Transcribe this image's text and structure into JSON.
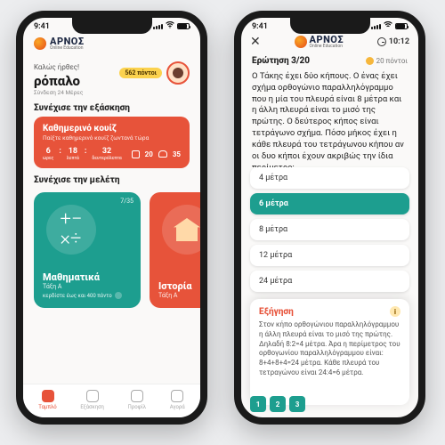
{
  "status": {
    "time": "9:41"
  },
  "brand": {
    "name": "ΑΡΝΟΣ",
    "sub": "Online Education"
  },
  "home": {
    "greeting_small": "Καλώς ήρθες!",
    "username": "ρόπαλο",
    "points_badge": "562 πόντοι",
    "streak": "Σύνδεση 24 Μέρες",
    "section_practice": "Συνέχισε την εξάσκηση",
    "quiz_card": {
      "title": "Καθημερινό κουίζ",
      "subtitle": "Παίξτε καθημερινό κουίζ ζωντανά τώρα",
      "hours": "6",
      "hours_l": "ώρες",
      "mins": "18",
      "mins_l": "λεπτά",
      "secs": "32",
      "secs_l": "δευτερόλεπτα",
      "q_count": "20",
      "players": "35"
    },
    "section_study": "Συνέχισε την μελέτη",
    "cards": [
      {
        "name": "Μαθηματικά",
        "grade": "Τάξη Α",
        "progress": "7/35",
        "reward": "κερδίστε έως και 400 πόντο"
      },
      {
        "name": "Ιστορία",
        "grade": "Τάξη Α",
        "progress": "",
        "reward": ""
      }
    ],
    "tabs": [
      "Ταμπλό",
      "Εξάσκηση",
      "Προφίλ",
      "Αγορά"
    ]
  },
  "quiz": {
    "timer": "10:12",
    "qnum": "Ερώτηση 3/20",
    "points": "20 πόντοι",
    "question": "Ο Τάκης έχει δύο κήπους. Ο ένας έχει σχήμα ορθογώνιο παραλληλόγραμμο που η μία του πλευρά είναι 8 μέτρα και η άλλη πλευρά είναι το μισό της πρώτης. Ο δεύτερος κήπος είναι τετράγωνο σχήμα. Πόσο μήκος έχει η κάθε πλευρά του τετράγωνου κήπου αν οι δυο κήποι έχουν ακριβώς την ίδια περίμετρο;",
    "answers": [
      "4 μέτρα",
      "6 μέτρα",
      "8 μέτρα",
      "12 μέτρα",
      "24 μέτρα"
    ],
    "selected_index": 1,
    "explain_title": "Εξήγηση",
    "explain_body": "Στον κήπο ορθογώνιου παραλληλόγραμμου η άλλη πλευρά είναι το μισό της πρώτης. Δηλαδή 8:2=4 μέτρα. Άρα η περίμετρος του ορθογωνίου παραλληλόγραμμου είναι: 8+4+8+4=24 μέτρα. Κάθε πλευρά του τετραγώνου είναι 24:4=6 μέτρα.",
    "steps": [
      "1",
      "2",
      "3"
    ]
  }
}
